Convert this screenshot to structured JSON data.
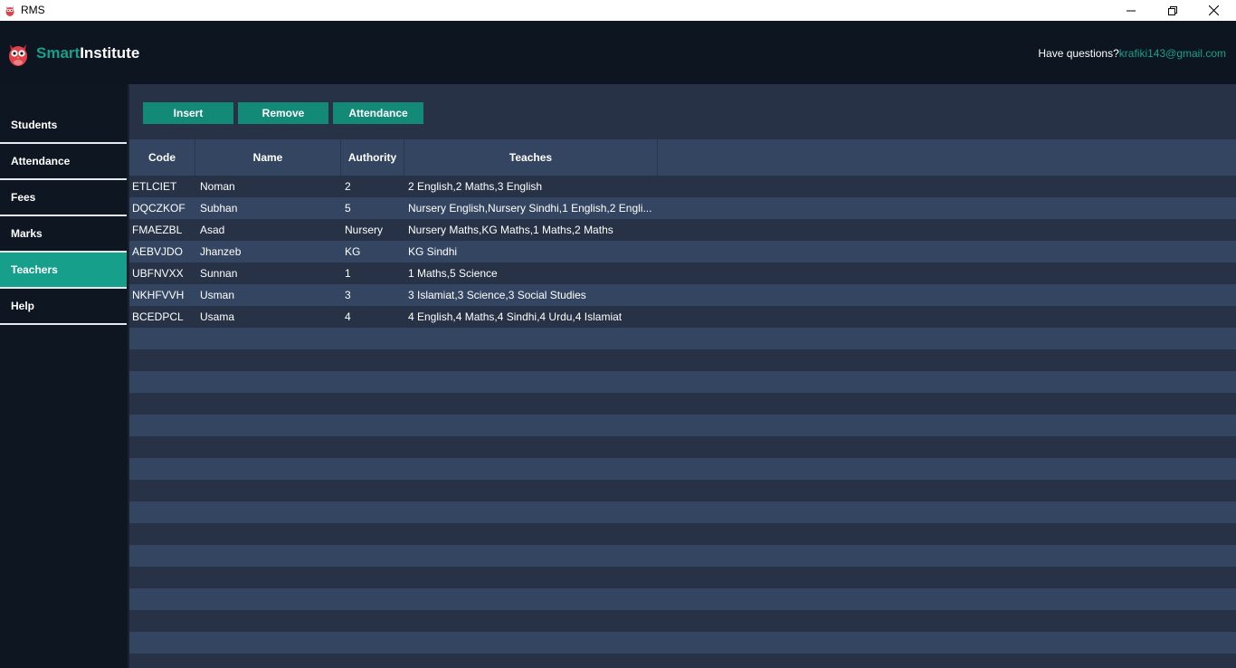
{
  "window": {
    "title": "RMS"
  },
  "header": {
    "brand_smart": "Smart",
    "brand_institute": "Institute",
    "help_prefix": "Have questions?",
    "help_email": "krafiki143@gmail.com"
  },
  "sidebar": {
    "items": [
      {
        "label": "Students"
      },
      {
        "label": "Attendance"
      },
      {
        "label": "Fees"
      },
      {
        "label": "Marks"
      },
      {
        "label": "Teachers",
        "active": true
      },
      {
        "label": "Help"
      }
    ]
  },
  "toolbar": {
    "insert_label": "Insert",
    "remove_label": "Remove",
    "attendance_label": "Attendance"
  },
  "table": {
    "headers": {
      "code": "Code",
      "name": "Name",
      "authority": "Authority",
      "teaches": "Teaches"
    },
    "rows": [
      {
        "code": "ETLCIET",
        "name": "Noman",
        "authority": "2",
        "teaches": "2 English,2 Maths,3 English"
      },
      {
        "code": "DQCZKOF",
        "name": "Subhan",
        "authority": "5",
        "teaches": "Nursery English,Nursery Sindhi,1 English,2 Engli..."
      },
      {
        "code": "FMAEZBL",
        "name": "Asad",
        "authority": "Nursery",
        "teaches": "Nursery Maths,KG Maths,1 Maths,2 Maths"
      },
      {
        "code": "AEBVJDO",
        "name": "Jhanzeb",
        "authority": "KG",
        "teaches": "KG Sindhi"
      },
      {
        "code": "UBFNVXX",
        "name": "Sunnan",
        "authority": "1",
        "teaches": "1 Maths,5 Science"
      },
      {
        "code": "NKHFVVH",
        "name": "Usman",
        "authority": "3",
        "teaches": "3 Islamiat,3 Science,3 Social Studies"
      },
      {
        "code": "BCEDPCL",
        "name": "Usama",
        "authority": "4",
        "teaches": "4 English,4 Maths,4 Sindhi,4 Urdu,4 Islamiat"
      }
    ]
  },
  "colors": {
    "accent": "#16a08c",
    "button": "#138a78",
    "header_bg": "#0d1520",
    "row_dark": "#273246",
    "row_light": "#344562"
  },
  "icons": {
    "app": "owl-icon",
    "logo": "owl-logo-icon",
    "minimize": "minimize-icon",
    "maximize": "restore-icon",
    "close": "close-icon"
  }
}
